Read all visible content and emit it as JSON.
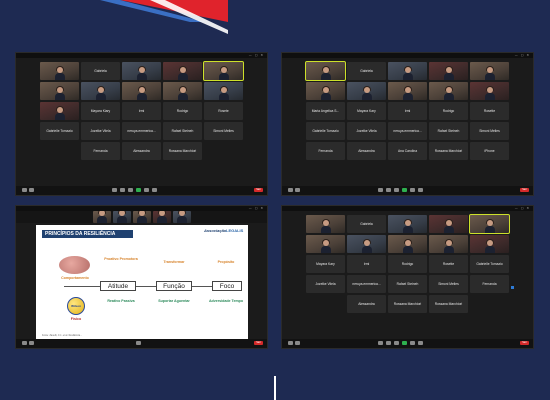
{
  "colors": {
    "background": "#1e2a52",
    "brand_red": "#e0232c",
    "brand_blue": "#3a6fc4",
    "active_speaker": "#cde02a",
    "end_button": "#d42a2a"
  },
  "windows": [
    {
      "id": "top-left",
      "toolbar_end": "Sair",
      "tiles": [
        {
          "type": "video",
          "tone": "warm",
          "active": false
        },
        {
          "type": "name",
          "label": "Gabriela"
        },
        {
          "type": "video",
          "tone": "cool"
        },
        {
          "type": "video",
          "tone": "red"
        },
        {
          "type": "video",
          "tone": "warm",
          "active": true
        },
        {
          "type": "video",
          "tone": "warm"
        },
        {
          "type": "video",
          "tone": "cool"
        },
        {
          "type": "video",
          "tone": "warm"
        },
        {
          "type": "video",
          "tone": "warm"
        },
        {
          "type": "video",
          "tone": "cool"
        },
        {
          "type": "video",
          "tone": "red"
        },
        {
          "type": "name",
          "label": "Mayara Kiary"
        },
        {
          "type": "name",
          "label": "Irmi"
        },
        {
          "type": "name",
          "label": "Rodrigo"
        },
        {
          "type": "name",
          "label": "Rosete"
        },
        {
          "type": "name",
          "label": "Gabrielle Tomazio"
        },
        {
          "type": "name",
          "label": "Jozelke Vilela"
        },
        {
          "type": "name",
          "label": "neruya.emmerica..."
        },
        {
          "type": "name",
          "label": "Rafael Steineh"
        },
        {
          "type": "name",
          "label": "Simoni Melles"
        },
        {
          "type": "empty"
        },
        {
          "type": "name",
          "label": "Fernanda"
        },
        {
          "type": "name",
          "label": "Alessandra"
        },
        {
          "type": "name",
          "label": "Rossana Marchiori"
        },
        {
          "type": "empty"
        }
      ]
    },
    {
      "id": "top-right",
      "toolbar_end": "Sair",
      "tiles": [
        {
          "type": "video",
          "tone": "warm",
          "active": true
        },
        {
          "type": "name",
          "label": "Gabriela"
        },
        {
          "type": "video",
          "tone": "cool"
        },
        {
          "type": "video",
          "tone": "red"
        },
        {
          "type": "video",
          "tone": "warm"
        },
        {
          "type": "video",
          "tone": "warm"
        },
        {
          "type": "video",
          "tone": "cool"
        },
        {
          "type": "video",
          "tone": "warm"
        },
        {
          "type": "video",
          "tone": "warm"
        },
        {
          "type": "video",
          "tone": "red"
        },
        {
          "type": "name",
          "label": "Maria Angelica S..."
        },
        {
          "type": "name",
          "label": "Mayara Kary"
        },
        {
          "type": "name",
          "label": "Irmi"
        },
        {
          "type": "name",
          "label": "Rodrigo"
        },
        {
          "type": "name",
          "label": "Rosette"
        },
        {
          "type": "name",
          "label": "Gabrielle Tomazio"
        },
        {
          "type": "name",
          "label": "Jozelke Vilela"
        },
        {
          "type": "name",
          "label": "neruya.emmerica..."
        },
        {
          "type": "name",
          "label": "Rafael Steineh"
        },
        {
          "type": "name",
          "label": "Simoni Melles"
        },
        {
          "type": "name",
          "label": "Fernanda"
        },
        {
          "type": "name",
          "label": "Alessandra"
        },
        {
          "type": "name",
          "label": "Ana Carolina"
        },
        {
          "type": "name",
          "label": "Rossana Marchiori"
        },
        {
          "type": "name",
          "label": "iPhone"
        }
      ]
    },
    {
      "id": "bottom-right",
      "toolbar_end": "Sair",
      "tiles": [
        {
          "type": "video",
          "tone": "warm"
        },
        {
          "type": "name",
          "label": "Gabriela"
        },
        {
          "type": "video",
          "tone": "cool"
        },
        {
          "type": "video",
          "tone": "red"
        },
        {
          "type": "video",
          "tone": "warm",
          "active": true
        },
        {
          "type": "video",
          "tone": "warm"
        },
        {
          "type": "video",
          "tone": "cool"
        },
        {
          "type": "video",
          "tone": "warm"
        },
        {
          "type": "video",
          "tone": "warm"
        },
        {
          "type": "video",
          "tone": "red"
        },
        {
          "type": "name",
          "label": "Mayara Kary"
        },
        {
          "type": "name",
          "label": "Irmi"
        },
        {
          "type": "name",
          "label": "Rodrigo"
        },
        {
          "type": "name",
          "label": "Rosette"
        },
        {
          "type": "name",
          "label": "Gabrielle Tomazio"
        },
        {
          "type": "name",
          "label": "Jozelke Vilela"
        },
        {
          "type": "name",
          "label": "neruya.emmerica..."
        },
        {
          "type": "name",
          "label": "Rafael Steineh"
        },
        {
          "type": "name",
          "label": "Simoni Melles"
        },
        {
          "type": "name",
          "label": "Fernanda"
        },
        {
          "type": "empty"
        },
        {
          "type": "name",
          "label": "Alessandra"
        },
        {
          "type": "name",
          "label": "Rossana Marchiori"
        },
        {
          "type": "name",
          "label": "Rossana Marchiori"
        },
        {
          "type": "empty"
        }
      ]
    }
  ],
  "slide": {
    "title": "PRINCÍPIOS DA RESILIÊNCIA",
    "logo_left": "Associação",
    "logo_right": "LEGALIS",
    "brain_caption": "Comportamento",
    "ball_caption": "Físico",
    "ball_text": "Wilson",
    "top_row": [
      {
        "text": "Proativo Promotora"
      },
      {
        "text": "Transformar"
      },
      {
        "text": "Propósito"
      }
    ],
    "middle_row": [
      "Atitude",
      "Função",
      "Foco"
    ],
    "bottom_row": [
      {
        "text": "Reativo Passiva"
      },
      {
        "text": "Suportar Aguentar"
      },
      {
        "text": "Adversidade Tempo"
      }
    ],
    "footer": "Fonte: Zanelli, J.C. et al. Resiliência..."
  }
}
